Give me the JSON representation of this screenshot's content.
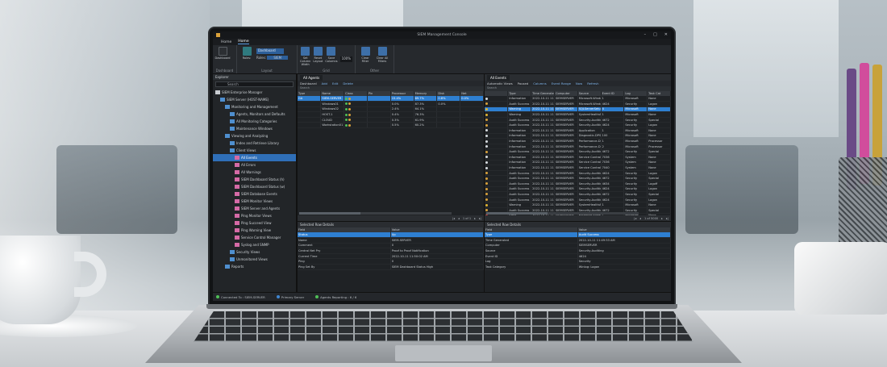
{
  "window": {
    "title": "SIEM Management Console"
  },
  "menu": {
    "items": [
      "Home",
      "Home"
    ],
    "active": 1
  },
  "ribbon": {
    "dashboard_label": "Dashboard",
    "dashboard_select": "Dashboard",
    "role_label": "Roles:",
    "role_value": "SIEM",
    "group_dashboard": "Dashboard",
    "group_layout": "Layout",
    "group_grid": "Grid",
    "group_other": "Other",
    "buttons": [
      "Set Column Width",
      "Reset Layout",
      "Save Columns",
      "Clear Filter",
      "Clear All Filters"
    ],
    "zoom": "100%"
  },
  "nav": {
    "header": "Explorer",
    "search_placeholder": "Search",
    "tree": [
      {
        "label": "SIEM Enterprise Manager",
        "icon": "wh",
        "indent": 0
      },
      {
        "label": "SIEM Server (HOST-NAME)",
        "icon": "blue",
        "indent": 1
      },
      {
        "label": "Monitoring and Management",
        "icon": "blue",
        "indent": 2
      },
      {
        "label": "Agents, Monitors and Defaults",
        "icon": "blue",
        "indent": 3
      },
      {
        "label": "All Monitoring Categories",
        "icon": "blue",
        "indent": 3
      },
      {
        "label": "Maintenance Windows",
        "icon": "blue",
        "indent": 3
      },
      {
        "label": "Viewing and Analyzing",
        "icon": "blue",
        "indent": 2
      },
      {
        "label": "Index and Retrieve Library",
        "icon": "blue",
        "indent": 3
      },
      {
        "label": "Client Views",
        "icon": "blue",
        "indent": 3
      },
      {
        "label": "All Events",
        "icon": "pink",
        "indent": 4,
        "selected": true
      },
      {
        "label": "All Errors",
        "icon": "pink",
        "indent": 4
      },
      {
        "label": "All Warnings",
        "icon": "pink",
        "indent": 4
      },
      {
        "label": "SIEM Dashboard Status (h)",
        "icon": "pink",
        "indent": 4
      },
      {
        "label": "SIEM Dashboard Status (w)",
        "icon": "pink",
        "indent": 4
      },
      {
        "label": "SIEM Database Events",
        "icon": "pink",
        "indent": 4
      },
      {
        "label": "SIEM Monitor Views",
        "icon": "pink",
        "indent": 4
      },
      {
        "label": "SIEM Server and Agents",
        "icon": "pink",
        "indent": 4
      },
      {
        "label": "Ping Monitor Views",
        "icon": "pink",
        "indent": 4
      },
      {
        "label": "Ping Succeed View",
        "icon": "pink",
        "indent": 4
      },
      {
        "label": "Ping Warning View",
        "icon": "pink",
        "indent": 4
      },
      {
        "label": "Service Control Manager",
        "icon": "pink",
        "indent": 4
      },
      {
        "label": "Syslog and SNMP",
        "icon": "pink",
        "indent": 4
      },
      {
        "label": "Security Views",
        "icon": "blue",
        "indent": 3
      },
      {
        "label": "Unmonitored Views",
        "icon": "blue",
        "indent": 3
      },
      {
        "label": "Reports",
        "icon": "blue",
        "indent": 2
      }
    ]
  },
  "agents_panel": {
    "tab": "All Agents",
    "subbar": [
      "Dashboard",
      "Add",
      "Edit",
      "Delete"
    ],
    "group_hint": "Search",
    "columns": [
      "Type",
      "Name",
      "Class",
      "Pin",
      "Processor",
      "Memory",
      "Disk",
      "Net"
    ],
    "rows": [
      {
        "type": "GA",
        "name": "SIEM-SERVER",
        "class": "S",
        "pin": "",
        "proc": "15.4%",
        "mem": "69.7%",
        "disk": "0.8%",
        "net": "0.0%",
        "selected": true
      },
      {
        "type": "",
        "name": "Windows01",
        "class": "S",
        "pin": "",
        "proc": "0.0%",
        "mem": "87.3%",
        "disk": "0.0%",
        "net": "",
        "selected": false
      },
      {
        "type": "",
        "name": "Windows02",
        "class": "S",
        "pin": "",
        "proc": "2.4%",
        "mem": "64.1%",
        "disk": "",
        "net": "",
        "selected": false
      },
      {
        "type": "",
        "name": "HOST-1",
        "class": "S",
        "pin": "",
        "proc": "0.4%",
        "mem": "76.3%",
        "disk": "",
        "net": "",
        "selected": false
      },
      {
        "type": "",
        "name": "CLOUD",
        "class": "S",
        "pin": "",
        "proc": "0.3%",
        "mem": "61.9%",
        "disk": "",
        "net": "",
        "selected": false
      },
      {
        "type": "",
        "name": "Workstation01",
        "class": "S",
        "pin": "",
        "proc": "0.5%",
        "mem": "60.2%",
        "disk": "",
        "net": "",
        "selected": false
      }
    ],
    "pager": "1 of 1"
  },
  "events_panel": {
    "tab": "All Events",
    "subbar": [
      "Automatic Views",
      "Paused",
      "Columns",
      "Event Range",
      "Now",
      "Refresh"
    ],
    "group_hint": "Search",
    "columns": [
      "",
      "Type",
      "Time Generated",
      "Computer",
      "Source",
      "Event ID",
      "Log",
      "Task Cat"
    ],
    "rows": [
      [
        "",
        "Information",
        "2022-10-11 11:49:55 AM",
        "SIEMSERVER",
        "Microsoft-Windows",
        "1",
        "Microsoft",
        "None"
      ],
      [
        "",
        "Audit Success",
        "2022-10-11 11:49:53 AM",
        "SIEMSERVER",
        "Microsoft-Windows",
        "4624",
        "Security",
        "Logon"
      ],
      [
        "",
        "Warning",
        "2022-10-11 11:49:50 AM",
        "SIEMSERVER",
        "SQLServerSetup",
        "4",
        "Microsoft",
        "None"
      ],
      [
        "",
        "Warning",
        "2022-10-11 11:49:48 AM",
        "SIEMSERVER",
        "SystemHealthAgent",
        "1",
        "Microsoft",
        "None"
      ],
      [
        "",
        "Audit Success",
        "2022-10-11 11:49:45 AM",
        "SIEMSERVER",
        "Security-Auditing",
        "4672",
        "Security",
        "Special"
      ],
      [
        "",
        "Audit Success",
        "2022-10-11 11:49:43 AM",
        "SIEMSERVER",
        "Security-Auditing",
        "4624",
        "Security",
        "Logon"
      ],
      [
        "",
        "Information",
        "2022-10-11 11:49:40 AM",
        "SIEMSERVER",
        "Application",
        "1",
        "Microsoft",
        "None"
      ],
      [
        "",
        "Information",
        "2022-10-11 11:49:38 AM",
        "SIEMSERVER",
        "Diagnostic-DPS",
        "100",
        "Microsoft",
        "None"
      ],
      [
        "",
        "Information",
        "2022-10-11 11:49:35 AM",
        "SIEMSERVER",
        "Performance-Dia",
        "1",
        "Microsoft",
        "Processor"
      ],
      [
        "",
        "Information",
        "2022-10-11 11:49:33 AM",
        "SIEMSERVER",
        "Performance-Dia",
        "2",
        "Microsoft",
        "Processor"
      ],
      [
        "",
        "Audit Success",
        "2022-10-11 11:49:30 AM",
        "SIEMSERVER",
        "Security-Auditing",
        "4672",
        "Security",
        "Special"
      ],
      [
        "",
        "Information",
        "2022-10-11 11:49:28 AM",
        "SIEMSERVER",
        "Service Control",
        "7036",
        "System",
        "None"
      ],
      [
        "",
        "Information",
        "2022-10-11 11:49:25 AM",
        "SIEMSERVER",
        "Service Control",
        "7036",
        "System",
        "None"
      ],
      [
        "",
        "Information",
        "2022-10-11 11:49:23 AM",
        "SIEMSERVER",
        "Service Control",
        "7040",
        "System",
        "None"
      ],
      [
        "",
        "Audit Success",
        "2022-10-11 11:49:20 AM",
        "SIEMSERVER",
        "Security-Auditing",
        "4624",
        "Security",
        "Logon"
      ],
      [
        "",
        "Audit Success",
        "2022-10-11 11:49:18 AM",
        "SIEMSERVER",
        "Security-Auditing",
        "4672",
        "Security",
        "Special"
      ],
      [
        "",
        "Audit Success",
        "2022-10-11 11:49:15 AM",
        "SIEMSERVER",
        "Security-Auditing",
        "4634",
        "Security",
        "Logoff"
      ],
      [
        "",
        "Audit Success",
        "2022-10-11 11:49:13 AM",
        "SIEMSERVER",
        "Security-Auditing",
        "4624",
        "Security",
        "Logon"
      ],
      [
        "",
        "Audit Success",
        "2022-10-11 11:49:10 AM",
        "SIEMSERVER",
        "Security-Auditing",
        "4672",
        "Security",
        "Special"
      ],
      [
        "",
        "Audit Success",
        "2022-10-11 11:49:08 AM",
        "SIEMSERVER",
        "Security-Auditing",
        "4624",
        "Security",
        "Logon"
      ],
      [
        "",
        "Warning",
        "2022-10-11 11:49:05 AM",
        "SIEMSERVER",
        "SystemHealthAgent",
        "1",
        "Microsoft",
        "None"
      ],
      [
        "",
        "Audit Success",
        "2022-10-11 11:49:03 AM",
        "SIEMSERVER",
        "Security-Auditing",
        "4672",
        "Security",
        "Special"
      ],
      [
        "",
        "Error",
        "2022-10-11 11:49:00 AM",
        "SIEMSERVER",
        "Microsoft-Windows",
        "1",
        "Microsoft",
        "None"
      ]
    ],
    "selected_row": 2,
    "pager": "1 of 5000"
  },
  "agent_details": {
    "title": "Selected Row Details",
    "columns": [
      "Field",
      "Value"
    ],
    "rows": [
      [
        "Status",
        "Up"
      ],
      [
        "Name",
        "SIEM-SERVER"
      ],
      [
        "Comment",
        "0"
      ],
      [
        "Central Net Pry",
        "Proof to Proof Notification"
      ],
      [
        "Current Time",
        "2022-10-11 11:50:02 AM"
      ],
      [
        "Ping",
        "0"
      ],
      [
        "Ping Set By",
        "SIEM Dashboard Status High"
      ]
    ],
    "selected_row": 0
  },
  "event_details": {
    "title": "Selected Row Details",
    "columns": [
      "Field",
      "Value"
    ],
    "rows": [
      [
        "Type",
        "Audit Success"
      ],
      [
        "Time Generated",
        "2022-10-11 11:49:53 AM"
      ],
      [
        "Computer",
        "SIEMSERVER"
      ],
      [
        "Source",
        "Security-Auditing"
      ],
      [
        "Event ID",
        "4624"
      ],
      [
        "Log",
        "Security"
      ],
      [
        "Task Category",
        "Winlog: Logon"
      ]
    ],
    "selected_row": 0
  },
  "statusbar": {
    "items": [
      "Connected To : SIEM-SERVER",
      "Primary Server",
      "Agents Reporting : 6 / 6"
    ]
  },
  "colors": {
    "accent": "#2e7fd1",
    "screen_bg": "#1e2125"
  }
}
